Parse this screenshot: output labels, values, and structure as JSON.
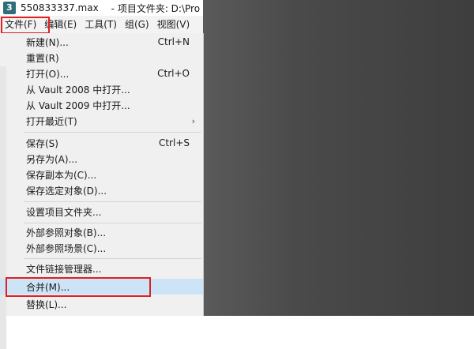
{
  "title_bar": {
    "file_name": "550833337.max",
    "project_label": "- 项目文件夹: D:\\Pro"
  },
  "menubar": {
    "items": [
      {
        "label": "文件(F)"
      },
      {
        "label": "编辑(E)"
      },
      {
        "label": "工具(T)"
      },
      {
        "label": "组(G)"
      },
      {
        "label": "视图(V)"
      }
    ]
  },
  "file_menu": {
    "items": [
      {
        "label": "新建(N)...",
        "shortcut": "Ctrl+N"
      },
      {
        "label": "重置(R)",
        "shortcut": ""
      },
      {
        "label": "打开(O)...",
        "shortcut": "Ctrl+O"
      },
      {
        "label": "从 Vault 2008 中打开...",
        "shortcut": ""
      },
      {
        "label": "从 Vault 2009 中打开...",
        "shortcut": ""
      },
      {
        "label": "打开最近(T)",
        "shortcut": "",
        "submenu_arrow": "›"
      },
      {
        "label": "保存(S)",
        "shortcut": "Ctrl+S"
      },
      {
        "label": "另存为(A)...",
        "shortcut": ""
      },
      {
        "label": "保存副本为(C)...",
        "shortcut": ""
      },
      {
        "label": "保存选定对象(D)...",
        "shortcut": ""
      },
      {
        "label": "设置项目文件夹...",
        "shortcut": ""
      },
      {
        "label": "外部参照对象(B)...",
        "shortcut": ""
      },
      {
        "label": "外部参照场景(C)...",
        "shortcut": ""
      },
      {
        "label": "文件链接管理器...",
        "shortcut": ""
      },
      {
        "label": "合并(M)...",
        "shortcut": "",
        "active": true
      },
      {
        "label": "替换(L)...",
        "shortcut": ""
      }
    ]
  },
  "colors": {
    "highlight_box": "#e02020",
    "active_item_bg": "#cde4f7",
    "menu_bg": "#f0f0f0",
    "background_dark": "#4a4a4a"
  },
  "icons": {
    "app": "3ds-max-app-icon",
    "submenu": "chevron-right-icon"
  }
}
